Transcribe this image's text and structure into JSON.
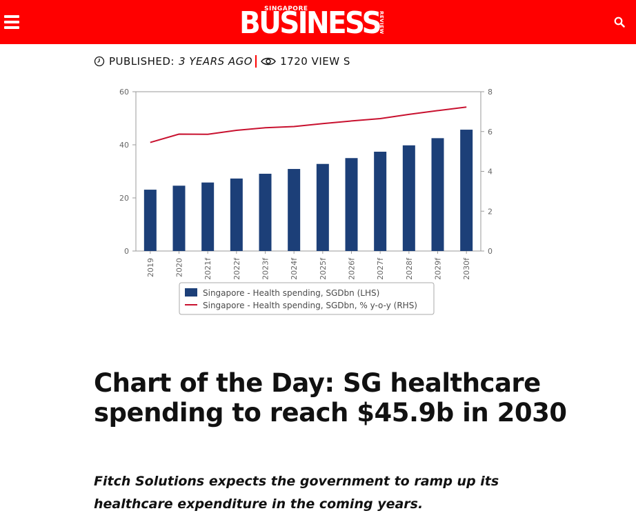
{
  "header": {
    "logo_top": "SINGAPORE",
    "logo_main": "BUSINESS",
    "logo_side": "REVIEW",
    "menu_icon": "hamburger-menu-icon",
    "search_icon": "search-icon",
    "bg_color": "#ff0000"
  },
  "meta": {
    "published_label": "PUBLISHED:",
    "published_value": "3 YEARS AGO",
    "views": "1720 VIEW S",
    "clock_icon": "clock-icon",
    "eye_icon": "eye-icon",
    "separator_color": "#ff0000"
  },
  "chart_data": {
    "type": "bar",
    "categories": [
      "2019",
      "2020",
      "2021f",
      "2022f",
      "2023f",
      "2024f",
      "2025f",
      "2026f",
      "2027f",
      "2028f",
      "2029f",
      "2030f"
    ],
    "series": [
      {
        "name": "Singapore - Health spending, SGDbn (LHS)",
        "type": "bar",
        "axis": "left",
        "color": "#1c3f78",
        "values": [
          23.1,
          24.6,
          25.8,
          27.3,
          29.1,
          30.9,
          32.8,
          35.0,
          37.4,
          39.8,
          42.5,
          45.7
        ]
      },
      {
        "name": "Singapore - Health spending, SGDbn, % y-o-y (RHS)",
        "type": "line",
        "axis": "right",
        "color": "#c8102e",
        "values": [
          5.45,
          5.87,
          5.86,
          6.06,
          6.19,
          6.25,
          6.4,
          6.53,
          6.65,
          6.86,
          7.05,
          7.23
        ]
      }
    ],
    "left_axis": {
      "min": 0,
      "max": 60,
      "ticks": [
        0,
        20,
        40,
        60
      ]
    },
    "right_axis": {
      "min": 0,
      "max": 8,
      "ticks": [
        0,
        2,
        4,
        6,
        8
      ]
    },
    "grid": false,
    "legend_position": "bottom"
  },
  "article": {
    "headline": "Chart of the Day: SG healthcare spending to reach $45.9b in 2030",
    "subhead": "Fitch Solutions expects the government to ramp up its healthcare expenditure in the coming years."
  }
}
